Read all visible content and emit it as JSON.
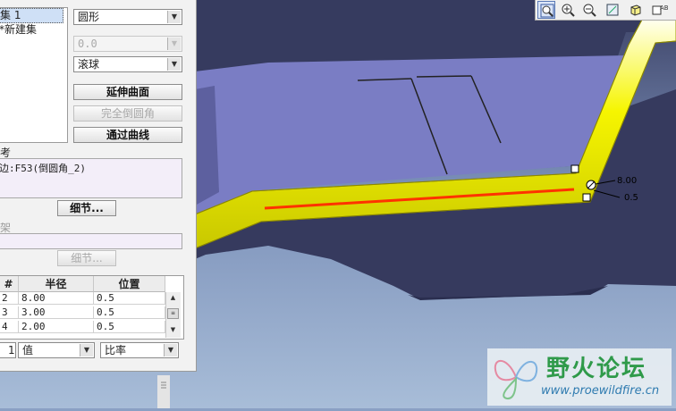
{
  "set_list": {
    "items": [
      "集 1",
      "*新建集"
    ]
  },
  "shape_select": {
    "value": "圆形"
  },
  "value_select": {
    "value": "0.0"
  },
  "method_select": {
    "value": "滚球"
  },
  "buttons": {
    "extend_surfaces": "延伸曲面",
    "full_round": "完全倒圆角",
    "through_curve": "通过曲线",
    "details_1": "细节...",
    "details_2": "细节..."
  },
  "references": {
    "label": "参考",
    "value": "边:F53(倒圆角_2)"
  },
  "skeleton": {
    "label": "骨架"
  },
  "radius_table": {
    "headers": [
      "#",
      "半径",
      "位置"
    ],
    "rows": [
      {
        "index": "2",
        "radius": "8.00",
        "position": "0.5"
      },
      {
        "index": "3",
        "radius": "3.00",
        "position": "0.5"
      },
      {
        "index": "4",
        "radius": "2.00",
        "position": "0.5"
      }
    ]
  },
  "bottom_row": {
    "index": "1",
    "type": "值",
    "mode": "比率"
  },
  "annotations": {
    "radius_tag": "8.00",
    "position_tag": "0.5"
  },
  "toolbar": {
    "icons": [
      "zoom-fit-icon",
      "zoom-in-icon",
      "zoom-out-icon",
      "repaint-icon",
      "view-orientation-icon",
      "saved-views-icon"
    ]
  },
  "watermark": {
    "title": "野火论坛",
    "url": "www.proewildfire.cn"
  },
  "colors": {
    "viewport_top": "#363b5f",
    "part_face": "#7a7dc4",
    "round_yellow": "#f6f500",
    "edge_red": "#ff3300",
    "panel_bg": "#f2f2f2"
  }
}
